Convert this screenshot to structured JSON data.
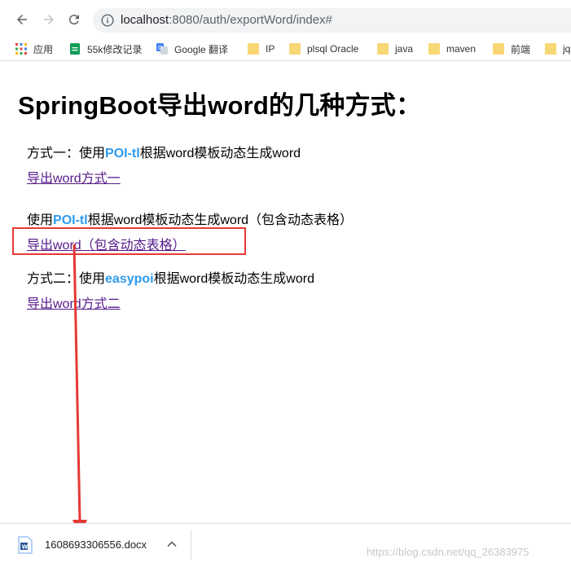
{
  "browser": {
    "url_host": "localhost",
    "url_path": ":8080/auth/exportWord/index#"
  },
  "bookmarks": [
    {
      "label": "应用",
      "icon": "apps-grid-icon"
    },
    {
      "label": "55k修改记录",
      "icon": "sheets-icon"
    },
    {
      "label": "Google 翻译",
      "icon": "google-translate-icon"
    },
    {
      "label": "IP",
      "icon": "folder-icon"
    },
    {
      "label": "plsql Oracle",
      "icon": "folder-icon"
    },
    {
      "label": "java",
      "icon": "folder-icon"
    },
    {
      "label": "maven",
      "icon": "folder-icon"
    },
    {
      "label": "前端",
      "icon": "folder-icon"
    },
    {
      "label": "jq",
      "icon": "folder-icon"
    }
  ],
  "page": {
    "title": "SpringBoot导出word的几种方式：",
    "section1": {
      "prefix": "方式一：使用",
      "highlight": "POI-tl",
      "suffix": "根据word模板动态生成word",
      "link": "导出word方式一"
    },
    "section2": {
      "prefix": "使用",
      "highlight": "POI-tl",
      "suffix": "根据word模板动态生成word（包含动态表格）",
      "link": "导出word（包含动态表格）"
    },
    "section3": {
      "prefix": "方式二：使用",
      "highlight": "easypoi",
      "suffix": "根据word模板动态生成word",
      "link": "导出word方式二"
    }
  },
  "downloads": {
    "file_name": "1608693306556.docx",
    "watermark": "https://blog.csdn.net/qq_26383975"
  },
  "colors": {
    "highlight": "#2e9bf0",
    "annotation": "#e53935",
    "visited_link": "#551a8b"
  }
}
